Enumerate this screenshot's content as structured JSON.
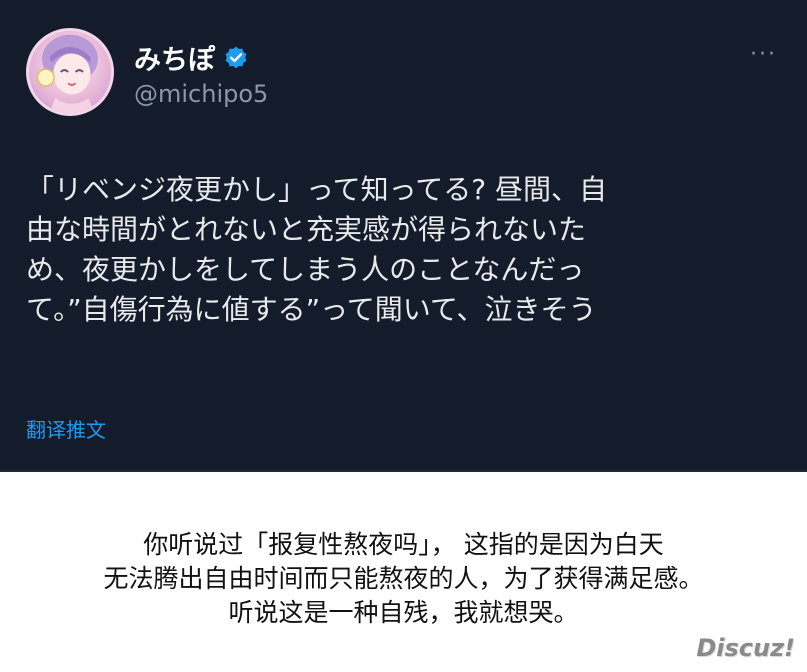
{
  "tweet": {
    "display_name": "みちぽ",
    "handle": "@michipo5",
    "verified_icon": "verified-badge-icon",
    "more_icon": "more-options-icon",
    "more_glyph": "···",
    "text": "「リベンジ夜更かし」って知ってる? 昼間、自\n由な時間がとれないと充実感が得られないた\nめ、夜更かしをしてしまう人のことなんだっ\nて。”自傷行為に値する”って聞いて、泣きそう",
    "translate_label": "翻译推文",
    "colors": {
      "background": "#141c2b",
      "text": "#e7e9ea",
      "handle": "#8b98a5",
      "link": "#1d9bf0",
      "verified": "#1d9bf0"
    }
  },
  "caption": {
    "text": "你听说过「报复性熬夜吗」，  这指的是因为白天\n无法腾出自由时间而只能熬夜的人，为了获得满足感。\n听说这是一种自残，我就想哭。"
  },
  "watermark": {
    "text": "Discuz!"
  }
}
